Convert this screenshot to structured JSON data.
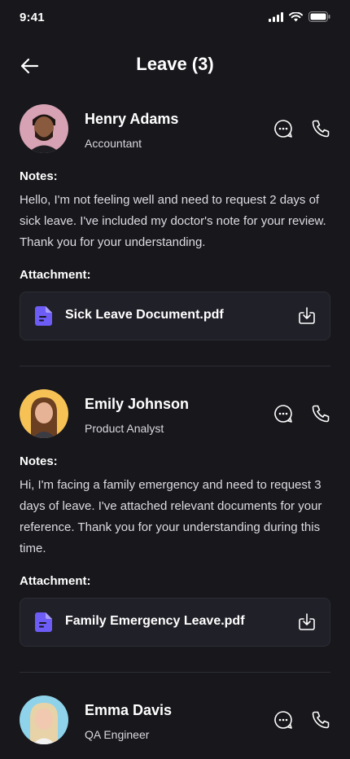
{
  "status": {
    "time": "9:41"
  },
  "header": {
    "title": "Leave (3)"
  },
  "labels": {
    "notes": "Notes:",
    "attachment": "Attachment:"
  },
  "colors": {
    "accent": "#6d5cf6",
    "background": "#17171c",
    "card": "#202028"
  },
  "employees": [
    {
      "name": "Henry Adams",
      "role": "Accountant",
      "notes": "Hello, I'm not feeling well and need to request 2 days of sick leave. I've included my doctor's note for your review. Thank you for your understanding.",
      "attachment": "Sick Leave Document.pdf",
      "avatar_bg": "#d7a2b3"
    },
    {
      "name": "Emily Johnson",
      "role": "Product Analyst",
      "notes": "Hi, I'm facing a family emergency and need to request 3 days of leave. I've attached relevant documents for your reference. Thank you for your understanding during this time.",
      "attachment": "Family Emergency Leave.pdf",
      "avatar_bg": "#f6c256"
    },
    {
      "name": "Emma Davis",
      "role": "QA Engineer",
      "avatar_bg": "#8fd3ea"
    }
  ]
}
